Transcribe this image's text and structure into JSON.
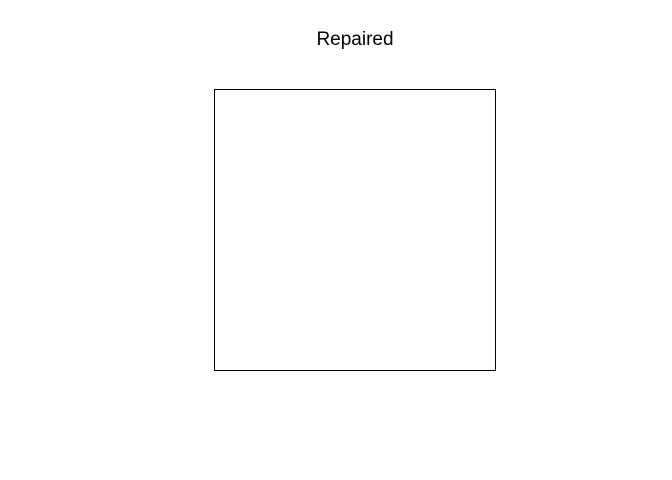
{
  "title": "Repaired"
}
